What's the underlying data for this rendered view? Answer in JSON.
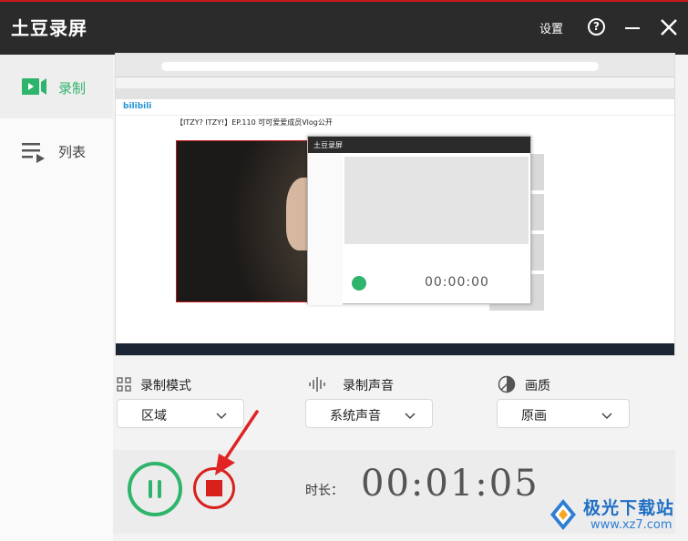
{
  "app": {
    "title": "土豆录屏",
    "settings_label": "设置",
    "help_label": "?"
  },
  "sidebar": {
    "items": [
      {
        "label": "录制",
        "icon": "video-camera-icon",
        "active": true
      },
      {
        "label": "列表",
        "icon": "list-icon",
        "active": false
      }
    ]
  },
  "preview": {
    "video_title": "【ITZY? ITZY!】EP.110 可可爱爱成员Vlog公开",
    "mini_app_title": "土豆录屏",
    "mini_timer": "00:00:00"
  },
  "options": {
    "record_mode": {
      "label": "录制模式",
      "value": "区域",
      "icon": "grid-icon"
    },
    "record_audio": {
      "label": "录制声音",
      "value": "系统声音",
      "icon": "sound-wave-icon"
    },
    "quality": {
      "label": "画质",
      "value": "原画",
      "icon": "quality-icon"
    }
  },
  "controls": {
    "duration_label": "时长：",
    "duration_value": "00:01:05"
  },
  "watermark": {
    "name": "极光下载站",
    "url": "www.xz7.com"
  },
  "colors": {
    "accent_green": "#2fb46b",
    "stop_red": "#d8211d",
    "titlebar": "#2b2b2b"
  }
}
